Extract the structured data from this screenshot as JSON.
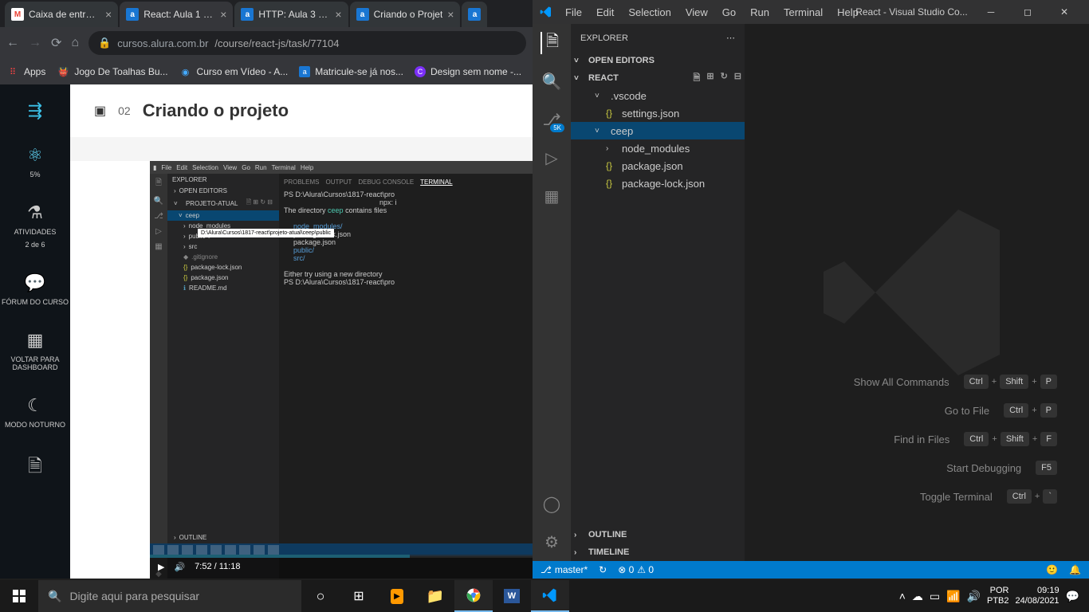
{
  "chrome": {
    "tabs": [
      {
        "label": "Caixa de entrada",
        "icon": "M",
        "iconBg": "#ea4335"
      },
      {
        "label": "React: Aula 1 - At",
        "icon": "a",
        "iconBg": "#1976d2"
      },
      {
        "label": "HTTP: Aula 3 - At",
        "icon": "a",
        "iconBg": "#1976d2"
      },
      {
        "label": "Criando o Projet",
        "icon": "a",
        "iconBg": "#1976d2"
      },
      {
        "label": "",
        "icon": "a",
        "iconBg": "#1976d2"
      }
    ],
    "url_prefix": "cursos.alura.com.br",
    "url_path": "/course/react-js/task/77104",
    "bookmarks": [
      {
        "label": "Apps",
        "icon": "⠿",
        "color": "#f44"
      },
      {
        "label": "Jogo De Toalhas Bu...",
        "icon": "👹",
        "color": "#fa0"
      },
      {
        "label": "Curso em Vídeo - A...",
        "icon": "◉",
        "color": "#4af"
      },
      {
        "label": "Matricule-se já nos...",
        "icon": "a",
        "color": "#1976d2"
      },
      {
        "label": "Design sem nome -...",
        "icon": "C",
        "color": "#7b2ff7"
      }
    ]
  },
  "alura": {
    "sidebar": {
      "toggle_icon": "⇶",
      "react_icon": "⚛",
      "progress": "5%",
      "activities_label": "ATIVIDADES",
      "activities_count": "2 de 6",
      "forum_label": "FÓRUM DO CURSO",
      "back_label": "VOLTAR PARA DASHBOARD",
      "dark_label": "MODO NOTURNO",
      "open_label": ""
    },
    "lesson": {
      "number": "02",
      "title": "Criando o projeto"
    },
    "video": {
      "current_time": "7:52",
      "duration": "11:18",
      "mini": {
        "menus": [
          "File",
          "Edit",
          "Selection",
          "View",
          "Go",
          "Run",
          "Terminal",
          "Help"
        ],
        "explorer": "EXPLORER",
        "open_editors": "OPEN EDITORS",
        "project": "PROJETO-ATUAL",
        "folder_ceep": "ceep",
        "items": [
          "node_modules",
          "public",
          "src",
          ".gitignore",
          "package-lock.json",
          "package.json",
          "README.md"
        ],
        "tooltip": "D:\\Alura\\Cursos\\1817-react\\projeto-atual\\ceep\\public",
        "outline": "OUTLINE",
        "term_tabs": [
          "PROBLEMS",
          "OUTPUT",
          "DEBUG CONSOLE",
          "TERMINAL"
        ],
        "term_line1": "PS D:\\Alura\\Cursos\\1817-react\\pro",
        "term_line2": "npx: i",
        "term_line3a": "The directory ",
        "term_line3b": "ceep",
        "term_line3c": " contains files",
        "term_line4": "node_modules/",
        "term_line5": "package-lock.json",
        "term_line6": "package.json",
        "term_line7": "public/",
        "term_line8": "src/",
        "term_line9": "Either try using a new directory ",
        "term_line10": "PS D:\\Alura\\Cursos\\1817-react\\pro"
      }
    }
  },
  "vscode": {
    "menus": [
      "File",
      "Edit",
      "Selection",
      "View",
      "Go",
      "Run",
      "Terminal",
      "Help"
    ],
    "title": "React - Visual Studio Co...",
    "explorer_label": "EXPLORER",
    "open_editors": "OPEN EDITORS",
    "project": "REACT",
    "scm_badge": "5K",
    "tree": {
      "vscode_folder": ".vscode",
      "settings": "settings.json",
      "ceep": "ceep",
      "node_modules": "node_modules",
      "package": "package.json",
      "package_lock": "package-lock.json"
    },
    "outline": "OUTLINE",
    "timeline": "TIMELINE",
    "commands": [
      {
        "label": "Show All Commands",
        "keys": [
          "Ctrl",
          "+",
          "Shift",
          "+",
          "P"
        ]
      },
      {
        "label": "Go to File",
        "keys": [
          "Ctrl",
          "+",
          "P"
        ]
      },
      {
        "label": "Find in Files",
        "keys": [
          "Ctrl",
          "+",
          "Shift",
          "+",
          "F"
        ]
      },
      {
        "label": "Start Debugging",
        "keys": [
          "F5"
        ]
      },
      {
        "label": "Toggle Terminal",
        "keys": [
          "Ctrl",
          "+",
          "`"
        ]
      }
    ],
    "status": {
      "branch": "master*",
      "sync": "↻",
      "errors": "⊗ 0",
      "warnings": "⚠ 0"
    }
  },
  "taskbar": {
    "search_placeholder": "Digite aqui para pesquisar",
    "lang1": "POR",
    "lang2": "PTB2",
    "time": "09:19",
    "date": "24/08/2021"
  }
}
